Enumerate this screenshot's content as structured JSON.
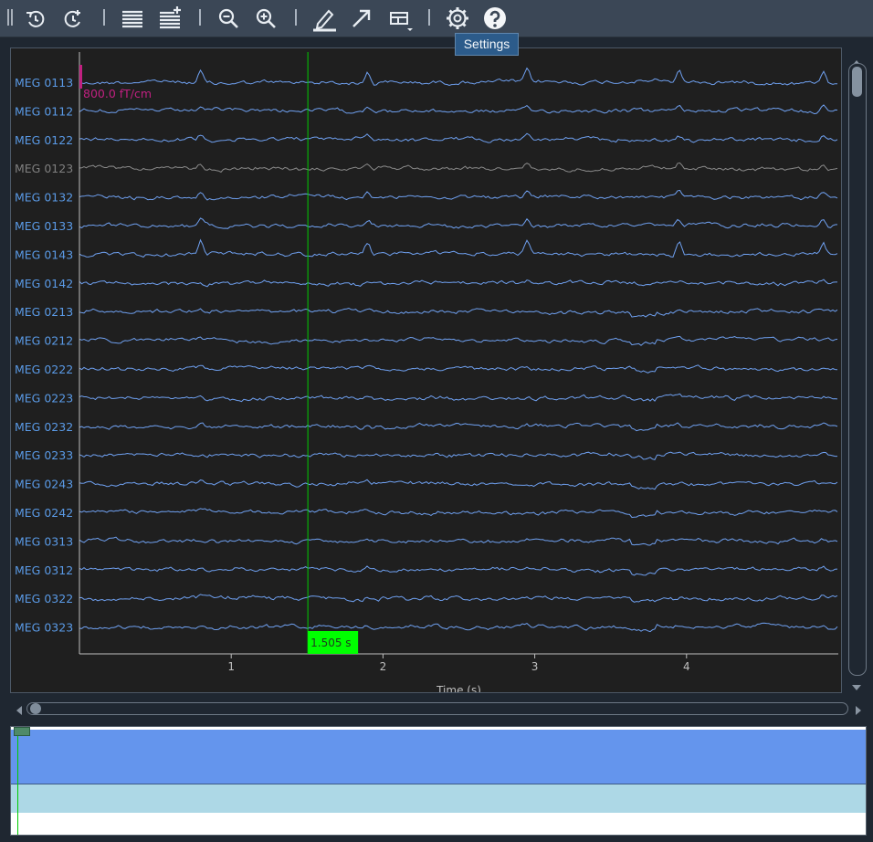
{
  "toolbar": {
    "buttons": [
      {
        "name": "rewind-icon",
        "label": "Rewind"
      },
      {
        "name": "forward-clock-icon",
        "label": "Forward"
      },
      {
        "name": "remove-channels-icon",
        "label": "Fewer channels"
      },
      {
        "name": "add-channels-icon",
        "label": "More channels"
      },
      {
        "name": "zoom-out-icon",
        "label": "Zoom out"
      },
      {
        "name": "zoom-in-icon",
        "label": "Zoom in"
      },
      {
        "name": "annotate-pencil-icon",
        "label": "Annotate"
      },
      {
        "name": "arrow-icon",
        "label": "Arrow"
      },
      {
        "name": "layout-icon",
        "label": "Layout"
      },
      {
        "name": "gear-icon",
        "label": "Settings"
      },
      {
        "name": "help-icon",
        "label": "Help"
      }
    ]
  },
  "tooltip": "Settings",
  "channels": [
    {
      "name": "MEG 0113",
      "bad": false
    },
    {
      "name": "MEG 0112",
      "bad": false
    },
    {
      "name": "MEG 0122",
      "bad": false
    },
    {
      "name": "MEG 0123",
      "bad": true
    },
    {
      "name": "MEG 0132",
      "bad": false
    },
    {
      "name": "MEG 0133",
      "bad": false
    },
    {
      "name": "MEG 0143",
      "bad": false
    },
    {
      "name": "MEG 0142",
      "bad": false
    },
    {
      "name": "MEG 0213",
      "bad": false
    },
    {
      "name": "MEG 0212",
      "bad": false
    },
    {
      "name": "MEG 0222",
      "bad": false
    },
    {
      "name": "MEG 0223",
      "bad": false
    },
    {
      "name": "MEG 0232",
      "bad": false
    },
    {
      "name": "MEG 0233",
      "bad": false
    },
    {
      "name": "MEG 0243",
      "bad": false
    },
    {
      "name": "MEG 0242",
      "bad": false
    },
    {
      "name": "MEG 0313",
      "bad": false
    },
    {
      "name": "MEG 0312",
      "bad": false
    },
    {
      "name": "MEG 0322",
      "bad": false
    },
    {
      "name": "MEG 0323",
      "bad": false
    }
  ],
  "scale_label": "800.0 fT/cm",
  "cursor": {
    "time": 1.505,
    "label": "1.505 s"
  },
  "x_axis": {
    "label": "Time (s)",
    "range": [
      0,
      5
    ],
    "ticks": [
      {
        "value": 1,
        "label": "1"
      },
      {
        "value": 2,
        "label": "2"
      },
      {
        "value": 3,
        "label": "3"
      },
      {
        "value": 4,
        "label": "4"
      }
    ]
  },
  "spike_times": [
    0.8,
    1.9,
    2.95,
    3.95,
    4.9
  ],
  "colors": {
    "trace": "#6fa0f0",
    "bad_trace": "#8a8a8a",
    "channel_label": "#5a9ae6",
    "bad_label": "#7f7f7f",
    "cursor": "#00cc00",
    "cursor_label_bg": "#00ff00",
    "scale": "#c02080",
    "overview_data": "#6495ed",
    "overview_annot": "#add8e6"
  }
}
